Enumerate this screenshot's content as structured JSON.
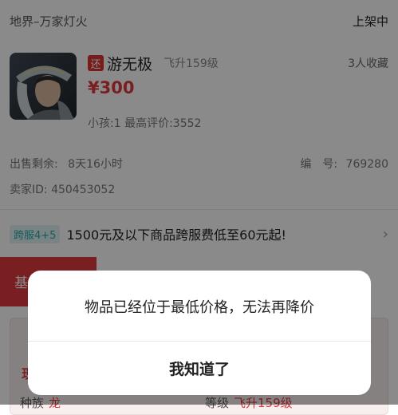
{
  "header": {
    "server": "地界–万家灯火",
    "status": "上架中"
  },
  "item": {
    "badge": "还",
    "role_name": "游无极",
    "role_level": "飞升159级",
    "collect_count": "3人收藏",
    "price": "¥300",
    "meta": "小孩:1 最高评价:3552"
  },
  "details": {
    "remain_label": "出售剩余:",
    "remain_value": "8天16小时",
    "number_label": "编　号:",
    "number_value": "769280",
    "seller_id": "卖家ID:  450453052"
  },
  "promo": {
    "tag": "跨服4+5",
    "text": "1500元及以下商品跨服费低至60元起!",
    "arrow": "›"
  },
  "tabs": {
    "basic": "基"
  },
  "card": {
    "head": "现",
    "race_label": "种族",
    "race_value": "龙",
    "level_label": "等级",
    "level_value": "飞升159级"
  },
  "dialog": {
    "message": "物品已经位于最低价格，无法再降价",
    "confirm_label": "我知道了"
  },
  "colors": {
    "accent_red": "#e0393e",
    "promo_teal": "#2aa8a8",
    "overlay": "rgba(0,0,0,0.46)"
  }
}
